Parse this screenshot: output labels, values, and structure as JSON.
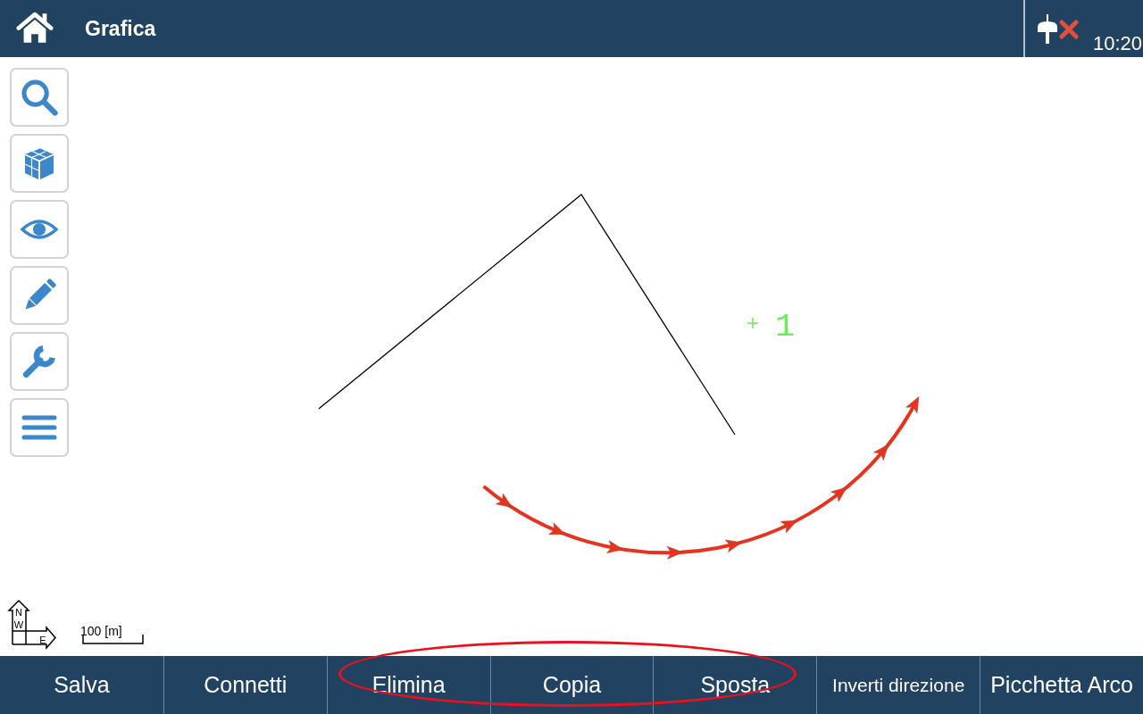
{
  "header": {
    "title": "Grafica",
    "receiver_connected": false,
    "time": "10:20"
  },
  "canvas": {
    "point": {
      "label": "1"
    },
    "compass": {
      "labels": [
        "N",
        "W",
        "E"
      ]
    },
    "scale": {
      "label": "100 [m]"
    }
  },
  "bottom_bar": {
    "buttons": [
      {
        "label": "Salva",
        "highlighted": false
      },
      {
        "label": "Connetti",
        "highlighted": false
      },
      {
        "label": "Elimina",
        "highlighted": true
      },
      {
        "label": "Copia",
        "highlighted": true
      },
      {
        "label": "Sposta",
        "highlighted": true
      },
      {
        "label": "Inverti direzione",
        "highlighted": false
      },
      {
        "label": "Picchetta Arco",
        "highlighted": false
      }
    ]
  }
}
